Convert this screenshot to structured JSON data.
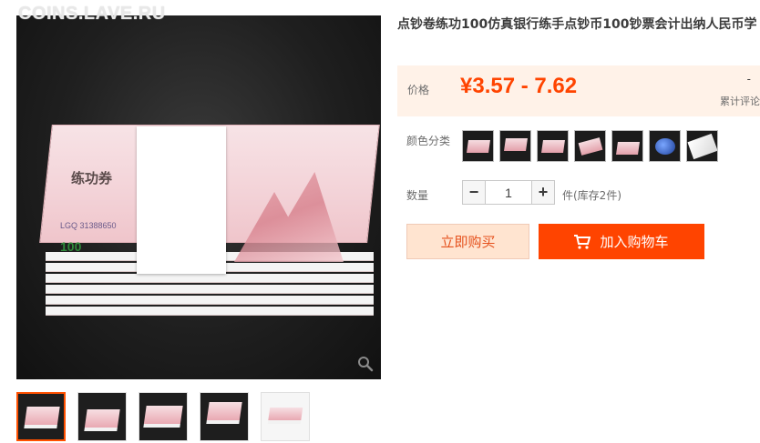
{
  "watermark": "COINS.LAVE.RU",
  "product": {
    "title": "点钞卷练功100仿真银行练手点钞币100钞票会计出纳人民币学",
    "image_note_label": "练功券",
    "image_note_serial": "LGQ 31388650",
    "image_note_value": "100"
  },
  "price": {
    "label": "价格",
    "value": "¥3.57 - 7.62",
    "review_count": "-",
    "review_label": "累计评论"
  },
  "sku": {
    "color_label": "颜色分类",
    "swatches": [
      "note-stack",
      "note-bundle",
      "note-single",
      "note-fan",
      "note-pile",
      "blue-sponge",
      "white-pad"
    ]
  },
  "quantity": {
    "label": "数量",
    "minus": "−",
    "value": "1",
    "plus": "+",
    "stock": "件(库存2件)"
  },
  "actions": {
    "buy_now": "立即购买",
    "add_to_cart": "加入购物车"
  },
  "colors": {
    "accent": "#ff4400",
    "price_bg": "#fff2e8",
    "buy_now_bg": "#ffe4d0"
  },
  "icons": {
    "zoom": "magnifier-icon",
    "cart": "shopping-cart-icon"
  }
}
